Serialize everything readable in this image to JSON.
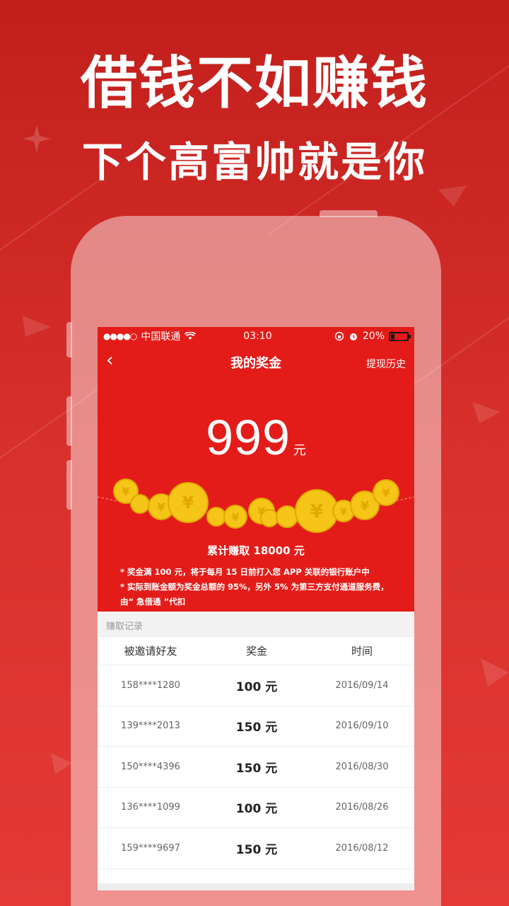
{
  "headline": {
    "line1": "借钱不如赚钱",
    "line2": "下个高富帅就是你"
  },
  "statusbar": {
    "signal": "●●●●○",
    "carrier": "中国联通",
    "time": "03:10",
    "battery": "20%"
  },
  "nav": {
    "back_icon": "‹",
    "title": "我的奖金",
    "history": "提现历史"
  },
  "bonus": {
    "amount": "999",
    "unit": "元",
    "total": "累计赚取 18000 元"
  },
  "notes": {
    "n1": "* 奖金满 100 元，将于每月 15 日前打入您 APP 关联的银行账户中",
    "n2": "* 实际到账金额为奖金总额的 95%，另外 5% 为第三方支付通道服务费，由“ 急借通 ”代扣"
  },
  "records": {
    "section_label": "赚取记录",
    "headers": [
      "被邀请好友",
      "奖金",
      "时间"
    ],
    "rows": [
      {
        "friend": "158****1280",
        "bonus": "100 元",
        "time": "2016/09/14"
      },
      {
        "friend": "139****2013",
        "bonus": "150 元",
        "time": "2016/09/10"
      },
      {
        "friend": "150****4396",
        "bonus": "150 元",
        "time": "2016/08/30"
      },
      {
        "friend": "136****1099",
        "bonus": "100 元",
        "time": "2016/08/26"
      },
      {
        "friend": "159****9697",
        "bonus": "150 元",
        "time": "2016/08/12"
      }
    ]
  },
  "colors": {
    "brand_red": "#e41c19",
    "background_red": "#d12a27",
    "coin_gold": "#f5c518"
  }
}
